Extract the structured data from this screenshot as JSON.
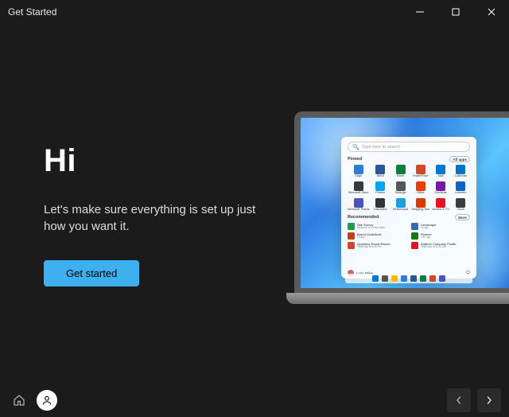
{
  "window": {
    "title": "Get Started"
  },
  "main": {
    "heading": "Hi",
    "subtext": "Let's make sure everything is set up just how you want it.",
    "cta": "Get started"
  },
  "start_menu": {
    "search_placeholder": "Type here to search",
    "pinned_label": "Pinned",
    "all_apps_label": "All apps",
    "recommended_label": "Recommended",
    "more_label": "More",
    "user": "Lynn Miles",
    "apps": [
      {
        "name": "Edge",
        "c": "#2e7cd6"
      },
      {
        "name": "Word",
        "c": "#2b5797"
      },
      {
        "name": "Excel",
        "c": "#107c41"
      },
      {
        "name": "PowerPoint",
        "c": "#d24726"
      },
      {
        "name": "Mail",
        "c": "#0078d4"
      },
      {
        "name": "Calendar",
        "c": "#0072c6"
      },
      {
        "name": "Microsoft Store",
        "c": "#3a3a3a"
      },
      {
        "name": "Photos",
        "c": "#00a4ef"
      },
      {
        "name": "Settings",
        "c": "#555"
      },
      {
        "name": "Office",
        "c": "#eb3c00"
      },
      {
        "name": "OneNote",
        "c": "#7719aa"
      },
      {
        "name": "LinkedIn",
        "c": "#0a66c2"
      },
      {
        "name": "Microsoft Teams",
        "c": "#4b53bc"
      },
      {
        "name": "Calculator",
        "c": "#333"
      },
      {
        "name": "Whiteboard",
        "c": "#1a9fde"
      },
      {
        "name": "Snipping Tool",
        "c": "#d83b01"
      },
      {
        "name": "Movies & TV",
        "c": "#e81123"
      },
      {
        "name": "Clock",
        "c": "#3b3b3b"
      }
    ],
    "recommended": [
      {
        "title": "Site Survey",
        "sub": "Welcome to a new folder",
        "c": "#1b9e4b"
      },
      {
        "title": "Landscape",
        "sub": "1h ago",
        "c": "#2f6fb0"
      },
      {
        "title": "Brand Guidelines",
        "sub": "2h ago",
        "c": "#c43e1c"
      },
      {
        "title": "Planner",
        "sub": "12m ago",
        "c": "#107c10"
      },
      {
        "title": "Quarterly Social Report",
        "sub": "Yesterday at 4:35 PM",
        "c": "#d24726"
      },
      {
        "title": "Adatum Company Profile",
        "sub": "Yesterday at 11:13 AM",
        "c": "#e81123"
      }
    ]
  },
  "colors": {
    "accent": "#3fb0ef"
  }
}
